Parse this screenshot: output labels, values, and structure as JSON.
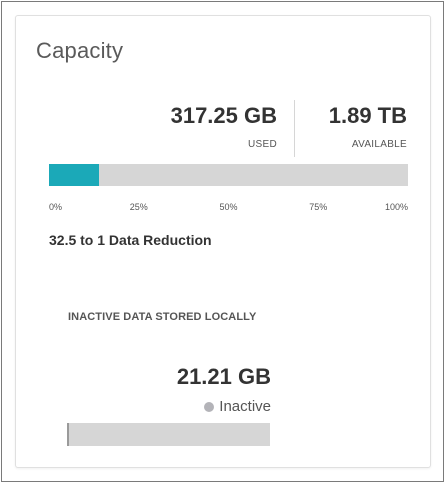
{
  "capacity": {
    "title": "Capacity",
    "used": {
      "value": "317.25 GB",
      "label": "USED"
    },
    "available": {
      "value": "1.89 TB",
      "label": "AVAILABLE"
    },
    "bar": {
      "used_fraction": 0.14,
      "fill_color": "#1ba9b8",
      "track_color": "#d6d6d6",
      "ticks": [
        "0%",
        "25%",
        "50%",
        "75%",
        "100%"
      ]
    },
    "reduction": "32.5 to 1 Data Reduction"
  },
  "inactive": {
    "heading": "INACTIVE DATA STORED LOCALLY",
    "value": "21.21 GB",
    "legend_label": "Inactive",
    "legend_color": "#b3b3b8",
    "bar": {
      "fraction": 0.0,
      "track_color": "#d6d6d6"
    }
  }
}
